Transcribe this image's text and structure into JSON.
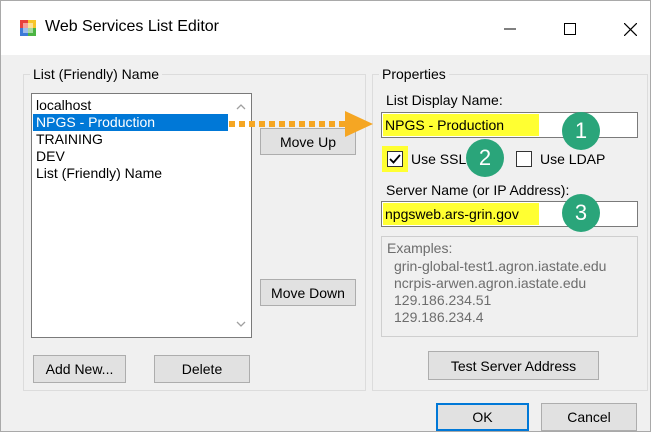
{
  "window": {
    "title": "Web Services List Editor"
  },
  "left_group": {
    "label": "List (Friendly) Name",
    "items": [
      {
        "label": "localhost",
        "selected": false
      },
      {
        "label": "NPGS - Production",
        "selected": true
      },
      {
        "label": "TRAINING",
        "selected": false
      },
      {
        "label": "DEV",
        "selected": false
      },
      {
        "label": "List (Friendly) Name",
        "selected": false
      }
    ],
    "move_up_label": "Move Up",
    "move_down_label": "Move Down",
    "add_new_label": "Add New...",
    "delete_label": "Delete"
  },
  "properties": {
    "label": "Properties",
    "list_display_name_label": "List Display Name:",
    "list_display_name_value": "NPGS - Production",
    "use_ssl_label": "Use SSL",
    "use_ssl_checked": true,
    "use_ldap_label": "Use LDAP",
    "use_ldap_checked": false,
    "server_name_label": "Server Name (or IP Address):",
    "server_name_value": "npgsweb.ars-grin.gov",
    "examples_title": "Examples:",
    "examples": [
      "grin-global-test1.agron.iastate.edu",
      "ncrpis-arwen.agron.iastate.edu",
      "129.186.234.51",
      "129.186.234.4"
    ],
    "test_server_label": "Test Server Address"
  },
  "dialog_buttons": {
    "ok_label": "OK",
    "cancel_label": "Cancel"
  },
  "annotations": {
    "badge_1": "1",
    "badge_2": "2",
    "badge_3": "3",
    "badge_color": "#2aa57a",
    "highlight_color": "#ffff32",
    "arrow_color": "#f5a623"
  },
  "colors": {
    "selection": "#0078d7",
    "window_bg": "#f0f0f0"
  }
}
